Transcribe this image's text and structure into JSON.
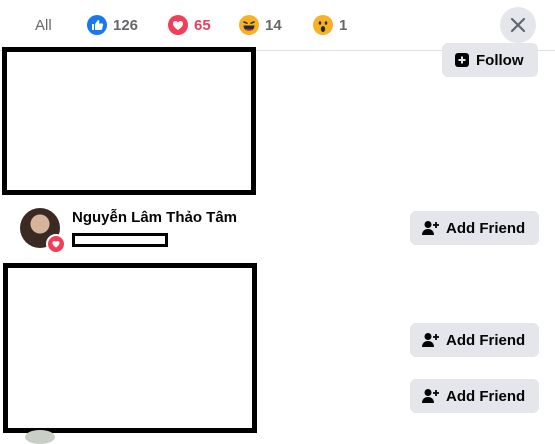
{
  "tabs": {
    "all": "All",
    "like_count": "126",
    "love_count": "65",
    "haha_count": "14",
    "wow_count": "1"
  },
  "icons": {
    "like": "like-reaction-icon",
    "love": "love-reaction-icon",
    "haha": "haha-reaction-icon",
    "wow": "wow-reaction-icon",
    "close": "close-icon"
  },
  "colors": {
    "like": "#1877f2",
    "love": "#e4405f",
    "button_bg": "#e4e6eb"
  },
  "people": [
    {
      "action": "Follow"
    },
    {
      "name": "Nguyễn Lâm Thảo Tâm",
      "action": "Add Friend"
    },
    {
      "action": "Add Friend"
    },
    {
      "action": "Add Friend"
    }
  ]
}
